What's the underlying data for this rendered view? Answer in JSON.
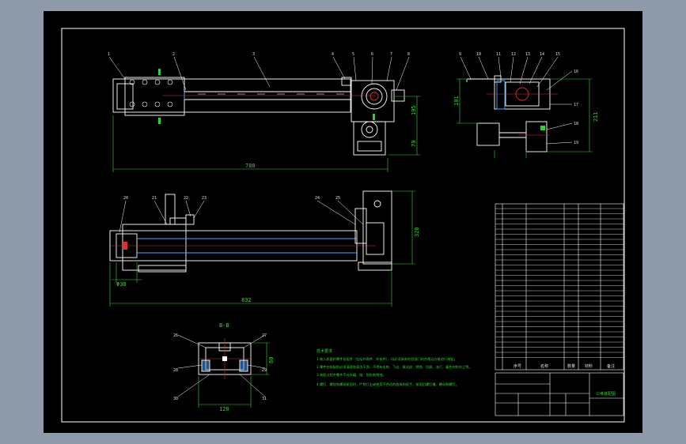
{
  "colors": {
    "background": "#8e99aa",
    "sheet": "#000000",
    "outline": "#ffffff",
    "dimension": "#3bd03b",
    "centerline": "#e03030",
    "hidden": "#4aa3ff"
  },
  "views": {
    "section_label": "B-B"
  },
  "dimensions": {
    "top_view_length": "780",
    "top_view_height_a": "195",
    "top_view_height_b": "70",
    "side_view_height": "211",
    "side_view_width": "101",
    "front_view_length": "832",
    "front_view_height": "320",
    "front_view_detail": "Φ30",
    "section_width": "120",
    "section_height": "80"
  },
  "balloons": {
    "top": [
      "1",
      "2",
      "3",
      "4",
      "5",
      "6",
      "7",
      "8"
    ],
    "side_top": [
      "9",
      "10",
      "11",
      "12",
      "13",
      "14",
      "15"
    ],
    "side_right": [
      "16",
      "17",
      "18",
      "19"
    ],
    "front_top": [
      "20",
      "21",
      "22",
      "23"
    ],
    "front_right": [
      "24",
      "25"
    ],
    "section": [
      "26",
      "27",
      "28",
      "29",
      "30",
      "31"
    ]
  },
  "tech_notes": {
    "title": "技术要求",
    "lines": [
      "1.装入机器的零件及组件（包括外购件、外协件），均必须具有检验部门的合格证方能进行装配。",
      "2.零件在装配前必须清理和清洗干净，不得有毛刺、飞边、氧化皮、锈蚀、切屑、油污、着色剂和灰尘等。",
      "3.装配过程中零件不允许磕、碰、划伤和锈蚀。",
      "4.螺钉、螺栓和螺母紧固时，严禁打击或使用不合适的旋具和扳手。紧固后螺钉槽、螺母和螺钉。"
    ]
  },
  "title_block": {
    "drawing_title": "三维装配图",
    "header_labels": [
      "序号",
      "名称",
      "数量",
      "材料",
      "备注"
    ]
  }
}
